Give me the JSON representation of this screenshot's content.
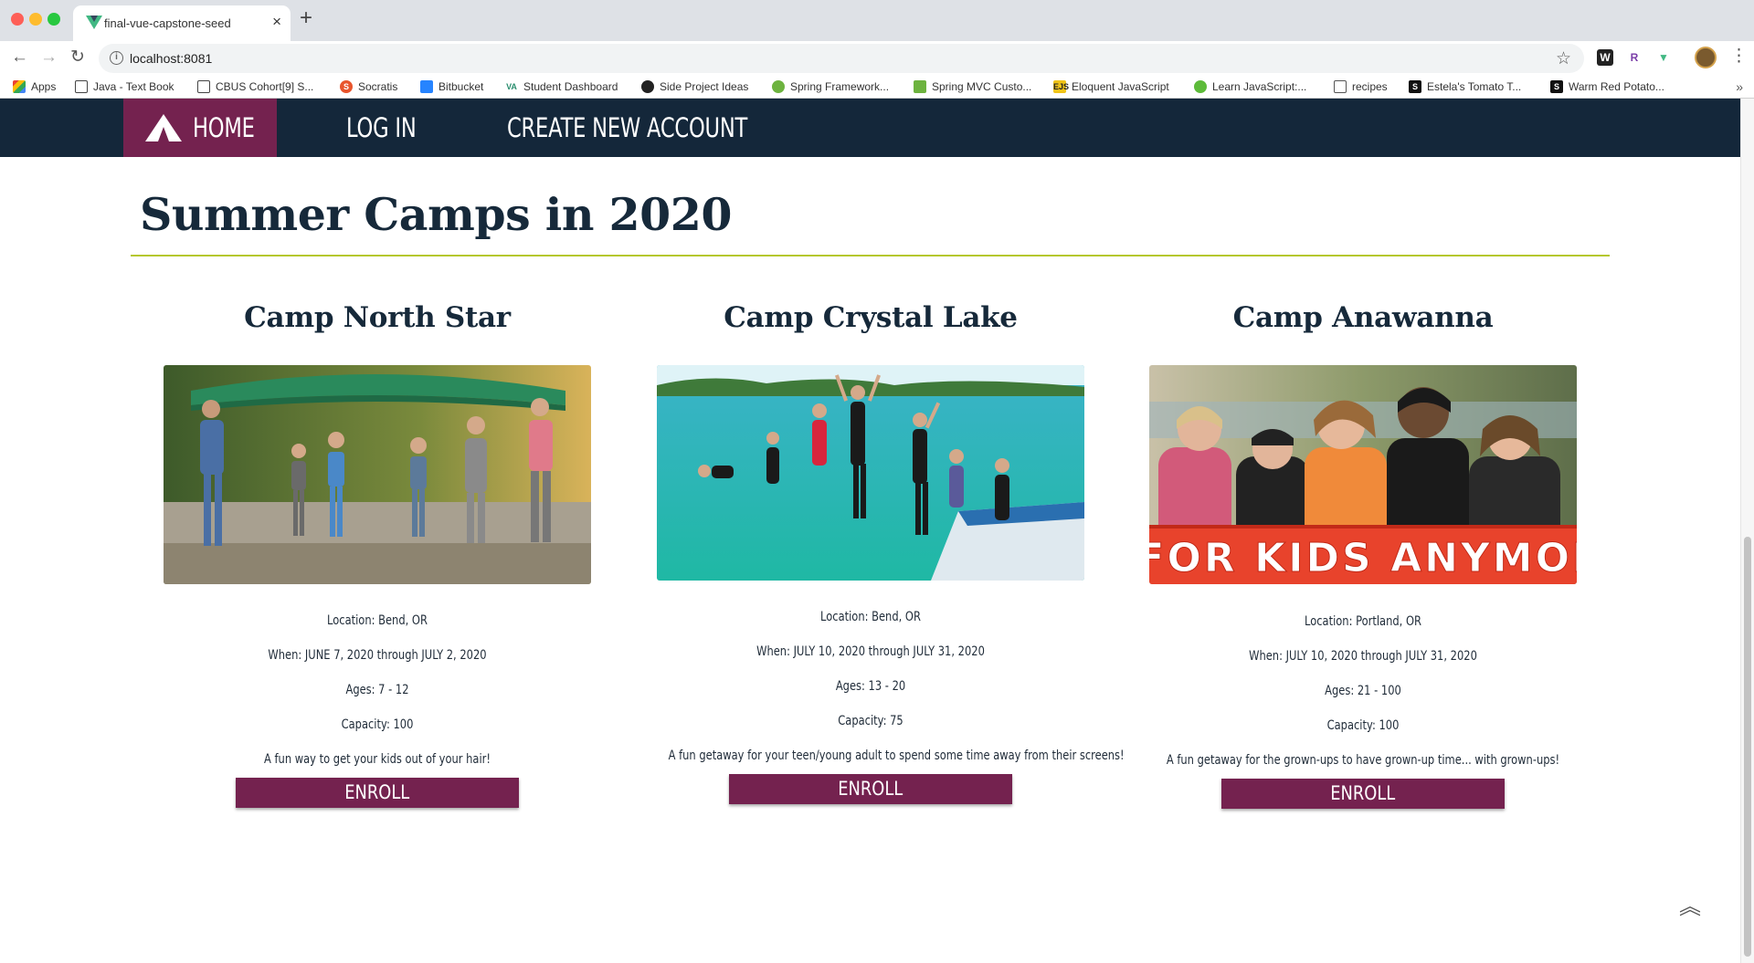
{
  "browser": {
    "tab_title": "final-vue-capstone-seed",
    "url": "localhost:8081",
    "bookmarks": [
      {
        "label": "Apps",
        "icon": "apps-grid-icon"
      },
      {
        "label": "Java - Text Book",
        "icon": "book-icon"
      },
      {
        "label": "CBUS Cohort[9] S...",
        "icon": "trello-icon"
      },
      {
        "label": "Socratis",
        "icon": "socratis-icon"
      },
      {
        "label": "Bitbucket",
        "icon": "bitbucket-icon"
      },
      {
        "label": "Student Dashboard",
        "icon": "dashboard-icon"
      },
      {
        "label": "Side Project Ideas",
        "icon": "github-icon"
      },
      {
        "label": "Spring Framework...",
        "icon": "spring-icon"
      },
      {
        "label": "Spring MVC Custo...",
        "icon": "spring-mvc-icon"
      },
      {
        "label": "Eloquent JavaScript",
        "icon": "ejs-icon"
      },
      {
        "label": "Learn JavaScript:...",
        "icon": "learn-js-icon"
      },
      {
        "label": "recipes",
        "icon": "folder-icon"
      },
      {
        "label": "Estela's Tomato T...",
        "icon": "s-square-icon"
      },
      {
        "label": "Warm Red Potato...",
        "icon": "s-square-icon"
      }
    ]
  },
  "nav": {
    "home": "HOME",
    "login": "LOG IN",
    "create_account": "CREATE NEW ACCOUNT"
  },
  "page": {
    "title": "Summer Camps in 2020"
  },
  "camps": [
    {
      "name": "Camp North Star",
      "location": "Location: Bend, OR",
      "when": "When: JUNE 7, 2020 through JULY 2, 2020",
      "ages": "Ages: 7 - 12",
      "capacity": "Capacity: 100",
      "description": "A fun way to get your kids out of your hair!",
      "enroll": "ENROLL",
      "photo": "people-carrying-canoe-photo"
    },
    {
      "name": "Camp Crystal Lake",
      "location": "Location: Bend, OR",
      "when": "When: JULY 10, 2020 through JULY 31, 2020",
      "ages": "Ages: 13 - 20",
      "capacity": "Capacity: 75",
      "description": "A fun getaway for your teen/young adult to spend some time away from their screens!",
      "enroll": "ENROLL",
      "photo": "teens-jumping-into-lake-photo"
    },
    {
      "name": "Camp Anawanna",
      "location": "Location: Portland, OR",
      "when": "When: JULY 10, 2020 through JULY 31, 2020",
      "ages": "Ages: 21 - 100",
      "capacity": "Capacity: 100",
      "description": "A fun getaway for the grown-ups to have grown-up time... with grown-ups!",
      "enroll": "ENROLL",
      "photo": "women-holding-banner-photo",
      "banner_text": "T FOR KIDS ANYMORE"
    }
  ],
  "colors": {
    "nav_bg": "#14273a",
    "accent": "#74224f",
    "rule": "#b5c72e",
    "title_text": "#16293a"
  }
}
